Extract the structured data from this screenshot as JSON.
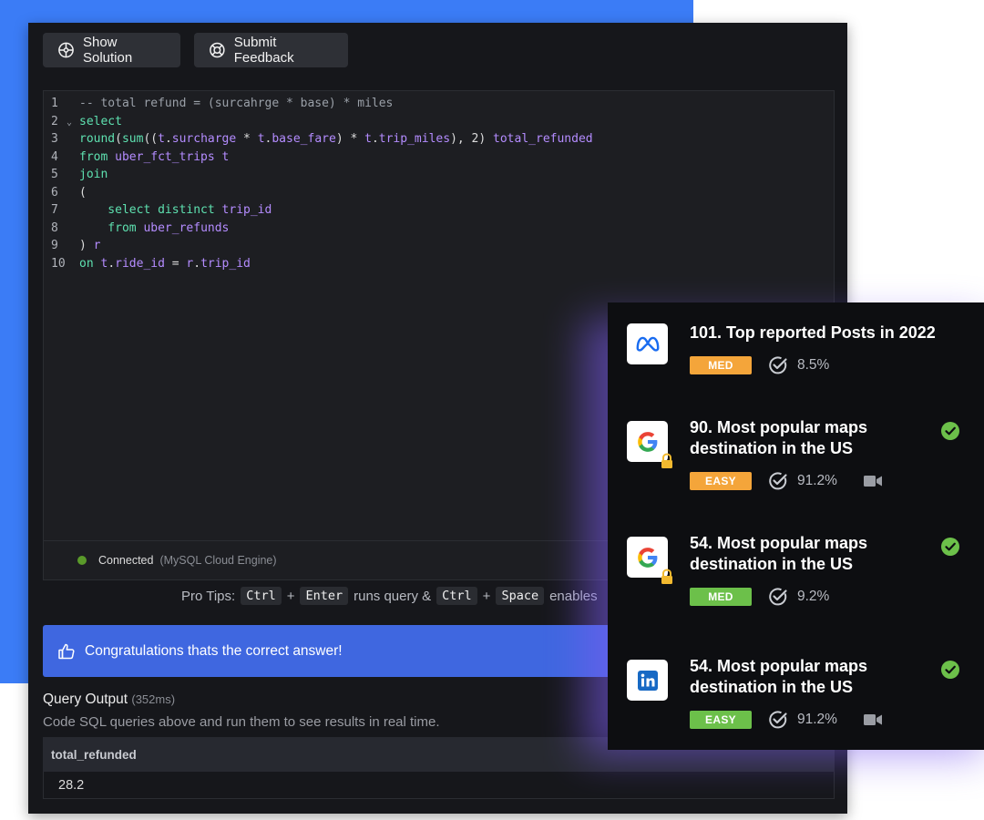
{
  "toolbar": {
    "show_solution": "Show Solution",
    "submit_feedback": "Submit Feedback"
  },
  "editor": {
    "lines": [
      {
        "num": "1",
        "fold": "",
        "tokens": [
          {
            "t": "-- total refund = (surcahrge * base) * miles",
            "c": "cm"
          }
        ]
      },
      {
        "num": "2",
        "fold": "⌄",
        "tokens": [
          {
            "t": "select",
            "c": "kw"
          }
        ]
      },
      {
        "num": "3",
        "fold": "",
        "tokens": [
          {
            "t": "round",
            "c": "kw"
          },
          {
            "t": "(",
            "c": "pl"
          },
          {
            "t": "sum",
            "c": "kw"
          },
          {
            "t": "((",
            "c": "pl"
          },
          {
            "t": "t",
            "c": "id"
          },
          {
            "t": ".",
            "c": "pl"
          },
          {
            "t": "surcharge",
            "c": "id"
          },
          {
            "t": " * ",
            "c": "pl"
          },
          {
            "t": "t",
            "c": "id"
          },
          {
            "t": ".",
            "c": "pl"
          },
          {
            "t": "base_fare",
            "c": "id"
          },
          {
            "t": ") * ",
            "c": "pl"
          },
          {
            "t": "t",
            "c": "id"
          },
          {
            "t": ".",
            "c": "pl"
          },
          {
            "t": "trip_miles",
            "c": "id"
          },
          {
            "t": "), 2) ",
            "c": "pl"
          },
          {
            "t": "total_refunded",
            "c": "id"
          }
        ]
      },
      {
        "num": "4",
        "fold": "",
        "tokens": [
          {
            "t": "from ",
            "c": "kw"
          },
          {
            "t": "uber_fct_trips t",
            "c": "id"
          }
        ]
      },
      {
        "num": "5",
        "fold": "",
        "tokens": [
          {
            "t": "join",
            "c": "kw"
          }
        ]
      },
      {
        "num": "6",
        "fold": "",
        "tokens": [
          {
            "t": "(",
            "c": "pl"
          }
        ]
      },
      {
        "num": "7",
        "fold": "",
        "tokens": [
          {
            "t": "    select distinct ",
            "c": "kw"
          },
          {
            "t": "trip_id",
            "c": "id"
          }
        ]
      },
      {
        "num": "8",
        "fold": "",
        "tokens": [
          {
            "t": "    from ",
            "c": "kw"
          },
          {
            "t": "uber_refunds",
            "c": "id"
          }
        ]
      },
      {
        "num": "9",
        "fold": "",
        "tokens": [
          {
            "t": ") ",
            "c": "pl"
          },
          {
            "t": "r",
            "c": "id"
          }
        ]
      },
      {
        "num": "10",
        "fold": "",
        "tokens": [
          {
            "t": "on ",
            "c": "kw"
          },
          {
            "t": "t",
            "c": "id"
          },
          {
            "t": ".",
            "c": "pl"
          },
          {
            "t": "ride_id",
            "c": "id"
          },
          {
            "t": " = ",
            "c": "pl"
          },
          {
            "t": "r",
            "c": "id"
          },
          {
            "t": ".",
            "c": "pl"
          },
          {
            "t": "trip_id",
            "c": "id"
          }
        ]
      }
    ]
  },
  "status": {
    "connected": "Connected",
    "engine": "(MySQL Cloud Engine)",
    "dot_color": "#5a9a2a"
  },
  "tips": {
    "label": "Pro Tips:",
    "key_ctrl": "Ctrl",
    "plus": "+",
    "key_enter": "Enter",
    "runs": "runs query &",
    "key_ctrl2": "Ctrl",
    "plus2": "+",
    "key_space": "Space",
    "enables": "enables"
  },
  "success": {
    "message": "Congratulations thats the correct answer!",
    "color": "#3f67e0"
  },
  "output": {
    "title": "Query Output",
    "time": "(352ms)",
    "description": "Code SQL queries above and run them to see results in real time.",
    "column": "total_refunded",
    "value": "28.2"
  },
  "questions": [
    {
      "logo": "meta-icon",
      "title": "101. Top reported Posts in 2022",
      "difficulty": "MED",
      "rate": "8.5%",
      "locked": false,
      "video": false,
      "solved": false
    },
    {
      "logo": "google-icon",
      "title": "90. Most popular maps destination in the US",
      "difficulty": "EASY",
      "rate": "91.2%",
      "locked": true,
      "video": true,
      "solved": true
    },
    {
      "logo": "google-icon",
      "title": "54. Most popular maps destination in the US",
      "difficulty": "MED",
      "rate": "9.2%",
      "locked": true,
      "video": false,
      "solved": true
    },
    {
      "logo": "linkedin-icon",
      "title": "54. Most popular maps destination in the US",
      "difficulty": "EASY",
      "rate": "91.2%",
      "locked": false,
      "video": true,
      "solved": true
    }
  ],
  "colors": {
    "accent_blue": "#3b7cf6",
    "badge_orange": "#f4a53a",
    "badge_green": "#6cc04a",
    "solved_green": "#6cc04a"
  }
}
